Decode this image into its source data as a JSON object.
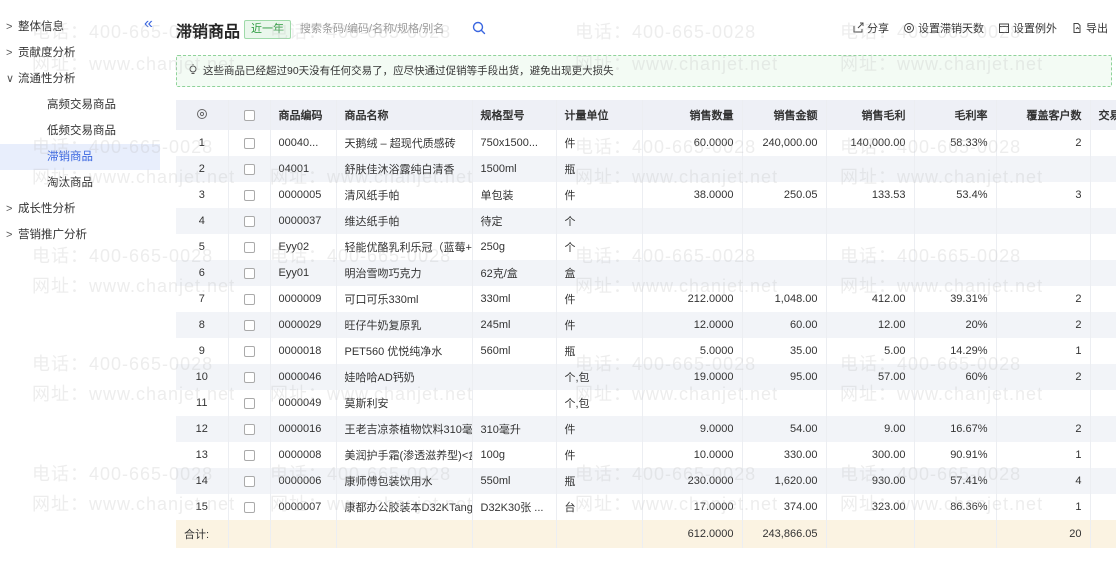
{
  "sidebar": {
    "collapse_icon": "double-chevron-left-icon",
    "items": [
      {
        "label": "整体信息",
        "arrow": "›",
        "level": 0
      },
      {
        "label": "贡献度分析",
        "arrow": "›",
        "level": 0
      },
      {
        "label": "流通性分析",
        "arrow": "⌄",
        "level": 0
      },
      {
        "label": "高频交易商品",
        "level": 1
      },
      {
        "label": "低频交易商品",
        "level": 1
      },
      {
        "label": "滞销商品",
        "level": 1,
        "active": true
      },
      {
        "label": "淘汰商品",
        "level": 1
      },
      {
        "label": "成长性分析",
        "arrow": "›",
        "level": 0
      },
      {
        "label": "营销推广分析",
        "arrow": "›",
        "level": 0
      }
    ]
  },
  "header": {
    "title": "滞销商品",
    "period_tag": "近一年",
    "search_placeholder": "搜索条码/编码/名称/规格/别名",
    "actions": {
      "share": "分享",
      "set_days": "设置滞销天数",
      "set_exception": "设置例外",
      "export": "导出"
    }
  },
  "notice": {
    "text": "这些商品已经超过90天没有任何交易了，应尽快通过促销等手段出货，避免出现更大损失"
  },
  "table": {
    "columns": [
      "",
      "",
      "商品编码",
      "商品名称",
      "规格型号",
      "计量单位",
      "销售数量",
      "销售金额",
      "销售毛利",
      "毛利率",
      "覆盖客户数",
      "交易"
    ],
    "rows": [
      [
        "1",
        "00040...",
        "天鹅绒 – 超现代质感砖",
        "750x1500...",
        "件",
        "60.0000",
        "240,000.00",
        "140,000.00",
        "58.33%",
        "2"
      ],
      [
        "2",
        "04001",
        "舒肤佳沐浴露纯白清香",
        "1500ml",
        "瓶",
        "",
        "",
        "",
        "",
        ""
      ],
      [
        "3",
        "0000005",
        "清风纸手帕",
        "单包装",
        "件",
        "38.0000",
        "250.05",
        "133.53",
        "53.4%",
        "3"
      ],
      [
        "4",
        "0000037",
        "维达纸手帕",
        "待定",
        "个",
        "",
        "",
        "",
        "",
        ""
      ],
      [
        "5",
        "Eyy02",
        "轻能优酪乳利乐冠（蓝莓+才",
        "250g",
        "个",
        "",
        "",
        "",
        "",
        ""
      ],
      [
        "6",
        "Eyy01",
        "明治雪吻巧克力",
        "62克/盒",
        "盒",
        "",
        "",
        "",
        "",
        ""
      ],
      [
        "7",
        "0000009",
        "可口可乐330ml",
        "330ml",
        "件",
        "212.0000",
        "1,048.00",
        "412.00",
        "39.31%",
        "2"
      ],
      [
        "8",
        "0000029",
        "旺仔牛奶复原乳",
        "245ml",
        "件",
        "12.0000",
        "60.00",
        "12.00",
        "20%",
        "2"
      ],
      [
        "9",
        "0000018",
        "PET560 优悦纯净水",
        "560ml",
        "瓶",
        "5.0000",
        "35.00",
        "5.00",
        "14.29%",
        "1"
      ],
      [
        "10",
        "0000046",
        "娃哈哈AD钙奶",
        "",
        "个,包",
        "19.0000",
        "95.00",
        "57.00",
        "60%",
        "2"
      ],
      [
        "11",
        "0000049",
        "莫斯利安",
        "",
        "个,包",
        "",
        "",
        "",
        "",
        ""
      ],
      [
        "12",
        "0000016",
        "王老吉凉茶植物饮料310毫升",
        "310毫升",
        "件",
        "9.0000",
        "54.00",
        "9.00",
        "16.67%",
        "2"
      ],
      [
        "13",
        "0000008",
        "美润护手霜(渗透滋养型)<盒",
        "100g",
        "件",
        "10.0000",
        "330.00",
        "300.00",
        "90.91%",
        "1"
      ],
      [
        "14",
        "0000006",
        "康师傅包装饮用水",
        "550ml",
        "瓶",
        "230.0000",
        "1,620.00",
        "930.00",
        "57.41%",
        "4"
      ],
      [
        "15",
        "0000007",
        "康都办公胶装本D32KTangl",
        "D32K30张 ...",
        "台",
        "17.0000",
        "374.00",
        "323.00",
        "86.36%",
        "1"
      ]
    ],
    "total": {
      "label": "合计:",
      "quantity": "612.0000",
      "amount": "243,866.05",
      "customers": "20"
    }
  },
  "watermark": {
    "phone": "电话：400-665-0028",
    "site": "网址：www.chanjet.net"
  },
  "colors": {
    "accent": "#3a66e0",
    "tag_green": "#2c9a3f",
    "total_row": "#fbf3e2",
    "header_row": "#eef0f6"
  }
}
